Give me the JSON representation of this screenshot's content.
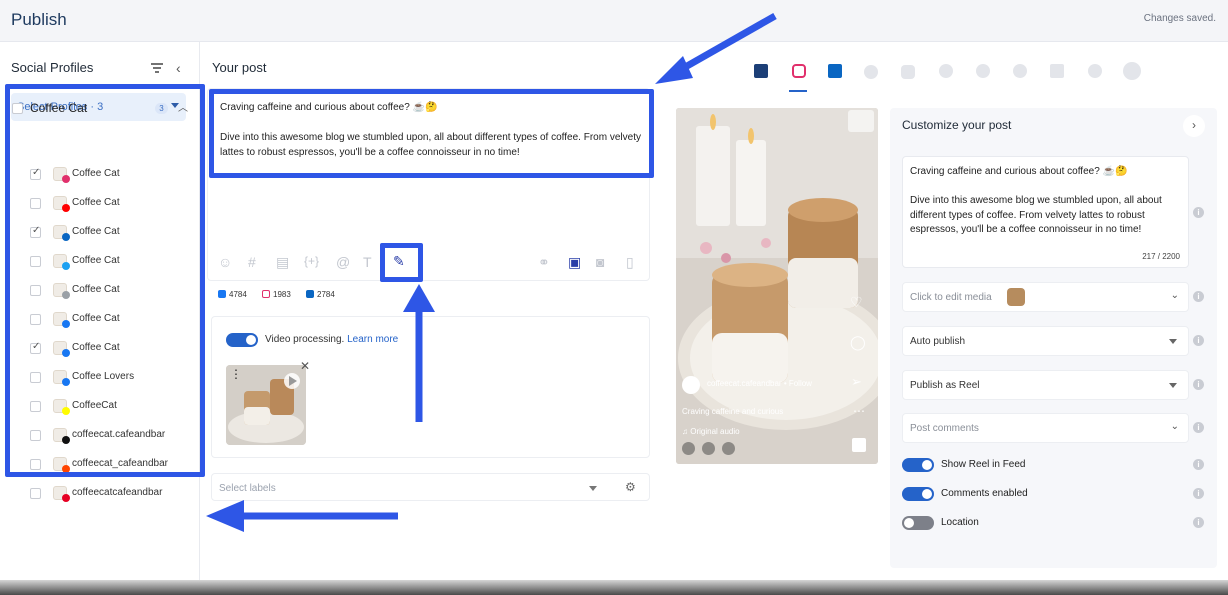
{
  "header": {
    "title": "Publish",
    "status": "Changes saved."
  },
  "sidebar": {
    "title": "Social Profiles",
    "select_label": "Select Profiles · 3",
    "group": {
      "name": "Coffee Cat",
      "count": "3"
    },
    "profiles": [
      {
        "name": "Coffee Cat",
        "checked": true,
        "network": "instagram",
        "color": "#e1306c"
      },
      {
        "name": "Coffee Cat",
        "checked": false,
        "network": "youtube",
        "color": "#ff0000"
      },
      {
        "name": "Coffee Cat",
        "checked": true,
        "network": "linkedin",
        "color": "#0a66c2"
      },
      {
        "name": "Coffee Cat",
        "checked": false,
        "network": "twitter",
        "color": "#1da1f2"
      },
      {
        "name": "Coffee Cat",
        "checked": false,
        "network": "google",
        "color": "#9aa0a6"
      },
      {
        "name": "Coffee Cat",
        "checked": false,
        "network": "facebook",
        "color": "#1877f2"
      },
      {
        "name": "Coffee Cat",
        "checked": true,
        "network": "facebook",
        "color": "#1877f2"
      },
      {
        "name": "Coffee Lovers",
        "checked": false,
        "network": "facebook",
        "color": "#1877f2"
      },
      {
        "name": "CoffeeCat",
        "checked": false,
        "network": "snapchat",
        "color": "#fffc00"
      },
      {
        "name": "coffeecat.cafeandbar",
        "checked": false,
        "network": "tiktok",
        "color": "#111111"
      },
      {
        "name": "coffeecat_cafeandbar",
        "checked": false,
        "network": "reddit",
        "color": "#ff4500"
      },
      {
        "name": "coffeecatcafeandbar",
        "checked": false,
        "network": "pinterest",
        "color": "#e60023"
      }
    ]
  },
  "editor": {
    "title": "Your post",
    "text": "Craving caffeine and curious about coffee? ☕🤔\n\nDive into this awesome blog we stumbled upon, all about different types of coffee. From velvety lattes to robust espressos, you'll be a coffee connoisseur in no time!",
    "counts": [
      {
        "network": "facebook",
        "value": "4784",
        "color": "#1877f2"
      },
      {
        "network": "instagram",
        "value": "1983",
        "color": "#e1306c"
      },
      {
        "network": "linkedin",
        "value": "2784",
        "color": "#0a66c2"
      }
    ],
    "video_processing_label": "Video processing.",
    "learn_more": "Learn more",
    "labels_placeholder": "Select labels"
  },
  "preview": {
    "account": "coffeecat.cafeandbar",
    "follow": "• Follow",
    "caption": "Craving caffeine and curious",
    "audio": "♫ Original audio"
  },
  "customize": {
    "title": "Customize your post",
    "text": "Craving caffeine and curious about coffee? ☕🤔\n\nDive into this awesome blog we stumbled upon, all about different types of coffee. From velvety lattes to robust espressos, you'll be a coffee connoisseur in no time!",
    "char_count": "217 / 2200",
    "media_label": "Click to edit media",
    "auto_publish": "Auto publish",
    "publish_as": "Publish as Reel",
    "post_comments": "Post comments",
    "toggles": [
      {
        "label": "Show Reel in Feed",
        "on": true
      },
      {
        "label": "Comments enabled",
        "on": true
      },
      {
        "label": "Location",
        "on": false
      }
    ]
  },
  "colors": {
    "accent": "#2563c9",
    "annotation": "#2e56e6"
  }
}
